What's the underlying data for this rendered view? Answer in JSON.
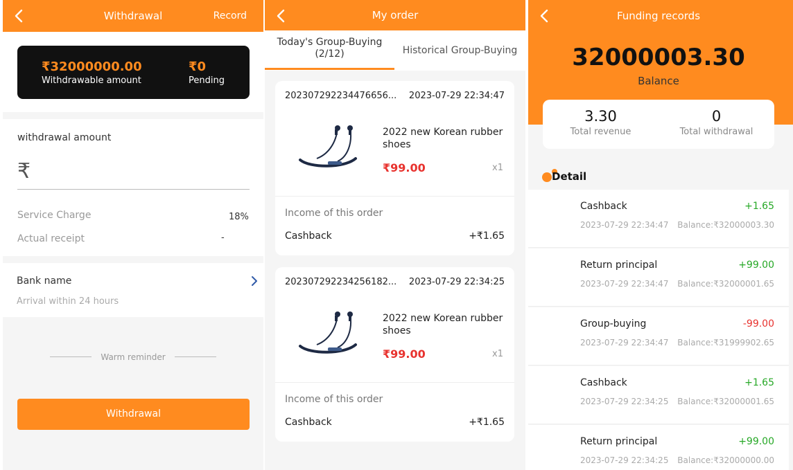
{
  "colors": {
    "accent": "#ff8b1f",
    "price_red": "#e8322e",
    "positive_green": "#26a826",
    "card_dark": "#111111"
  },
  "withdrawal": {
    "header": {
      "title": "Withdrawal",
      "right": "Record",
      "back_icon": "chevron-left-icon"
    },
    "balance_card": {
      "withdrawable_amount": "₹32000000.00",
      "withdrawable_label": "Withdrawable amount",
      "pending_amount": "₹0",
      "pending_label": "Pending"
    },
    "amount_label": "withdrawal amount",
    "currency_symbol": "₹",
    "amount_value": "",
    "service_charge_label": "Service Charge",
    "service_charge_value": "18%",
    "actual_receipt_label": "Actual receipt",
    "actual_receipt_value": "-",
    "bank": {
      "name": "Bank name",
      "subtitle": "Arrival within 24 hours",
      "chevron_icon": "chevron-right-icon"
    },
    "reminder": "Warm reminder",
    "button": "Withdrawal"
  },
  "my_order": {
    "header": {
      "title": "My order",
      "back_icon": "chevron-left-icon"
    },
    "tabs": [
      {
        "label_line1": "Today's Group-Buying",
        "label_line2": "(2/12)",
        "active": true
      },
      {
        "label_line1": "Historical Group-Buying",
        "label_line2": "",
        "active": false
      }
    ],
    "orders": [
      {
        "id": "202307292234476656...",
        "date": "2023-07-29 22:34:47",
        "product_name": "2022 new Korean rubber shoes",
        "price": "₹99.00",
        "quantity": "x1",
        "income_label": "Income of this order",
        "cashback_label": "Cashback",
        "cashback_value": "+₹1.65",
        "image_icon": "neckband-earphones-image"
      },
      {
        "id": "202307292234256182...",
        "date": "2023-07-29 22:34:25",
        "product_name": "2022 new Korean rubber shoes",
        "price": "₹99.00",
        "quantity": "x1",
        "income_label": "Income of this order",
        "cashback_label": "Cashback",
        "cashback_value": "+₹1.65",
        "image_icon": "neckband-earphones-image"
      }
    ]
  },
  "funding": {
    "header": {
      "title": "Funding records",
      "back_icon": "chevron-left-icon"
    },
    "balance": "32000003.30",
    "balance_label": "Balance",
    "stats": [
      {
        "value": "3.30",
        "label": "Total revenue"
      },
      {
        "value": "0",
        "label": "Total withdrawal"
      }
    ],
    "detail_label": "Detail",
    "records": [
      {
        "title": "Cashback",
        "amount": "+1.65",
        "sign": "pos",
        "date": "2023-07-29 22:34:47",
        "balance": "Balance:₹32000003.30"
      },
      {
        "title": "Return principal",
        "amount": "+99.00",
        "sign": "pos",
        "date": "2023-07-29 22:34:47",
        "balance": "Balance:₹32000001.65"
      },
      {
        "title": "Group-buying",
        "amount": "-99.00",
        "sign": "neg",
        "date": "2023-07-29 22:34:47",
        "balance": "Balance:₹31999902.65"
      },
      {
        "title": "Cashback",
        "amount": "+1.65",
        "sign": "pos",
        "date": "2023-07-29 22:34:25",
        "balance": "Balance:₹32000001.65"
      },
      {
        "title": "Return principal",
        "amount": "+99.00",
        "sign": "pos",
        "date": "2023-07-29 22:34:25",
        "balance": "Balance:₹32000000.00"
      }
    ]
  }
}
